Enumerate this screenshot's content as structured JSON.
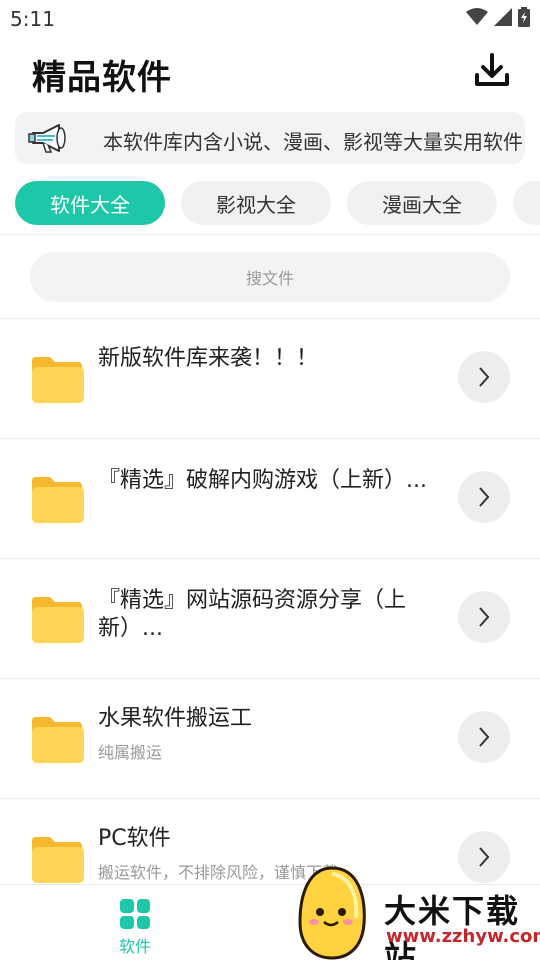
{
  "status_bar": {
    "time": "5:11"
  },
  "header": {
    "title": "精品软件",
    "download_icon": "download-icon"
  },
  "notice": {
    "text": "本软件库内含小说、漫画、影视等大量实用软件",
    "icon": "megaphone-icon"
  },
  "tabs": [
    {
      "label": "软件大全",
      "active": true
    },
    {
      "label": "影视大全",
      "active": false
    },
    {
      "label": "漫画大全",
      "active": false
    },
    {
      "label": "",
      "active": false
    }
  ],
  "search": {
    "placeholder": "搜文件"
  },
  "files": [
    {
      "name": "新版软件库来袭！！！",
      "sub": ""
    },
    {
      "name": "『精选』破解内购游戏（上新）...",
      "sub": ""
    },
    {
      "name": "『精选』网站源码资源分享（上新）...",
      "sub": ""
    },
    {
      "name": "水果软件搬运工",
      "sub": "纯属搬运"
    },
    {
      "name": "PC软件",
      "sub": "搬运软件，不排除风险，谨慎下载"
    }
  ],
  "bottom_nav": {
    "label": "软件",
    "icon": "grid-icon"
  },
  "watermark": {
    "brand": "大米下载站",
    "site": "www.zzhyw.com"
  },
  "colors": {
    "accent": "#1ec7a8",
    "folder": "#ffd556",
    "folder_tab": "#f5b82e"
  }
}
